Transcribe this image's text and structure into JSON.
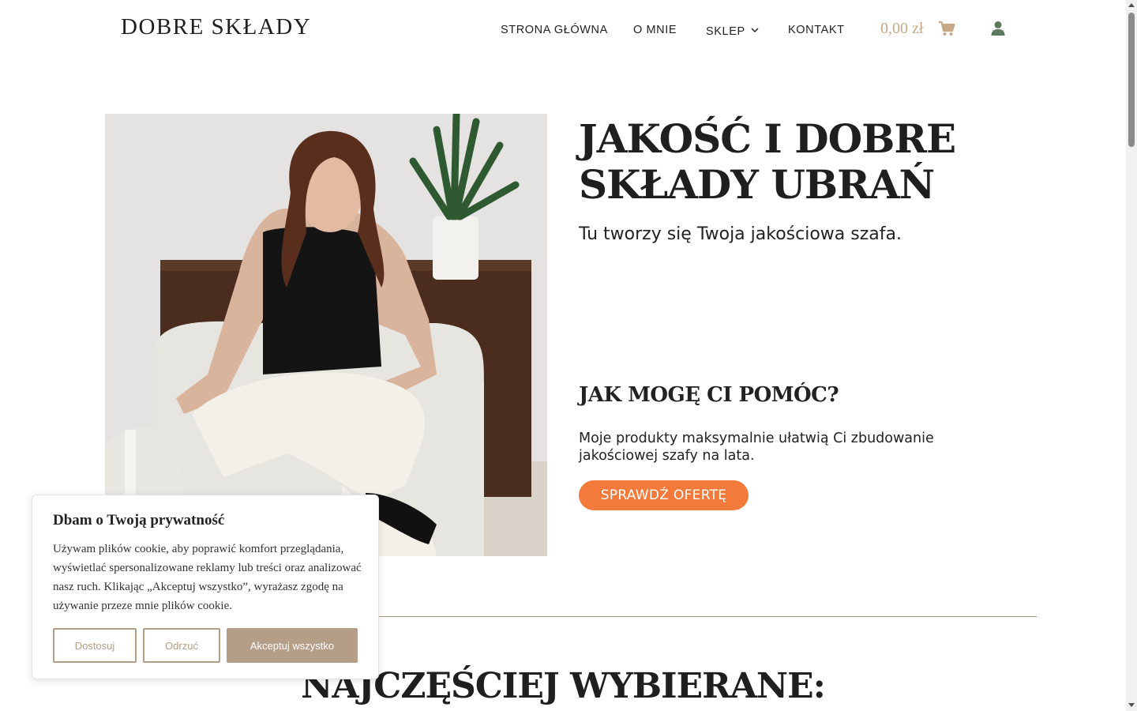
{
  "header": {
    "logo": "DOBRE SKŁADY",
    "nav": {
      "home": "STRONA GŁÓWNA",
      "about": "O MNIE",
      "shop": "SKLEP",
      "contact": "KONTAKT"
    },
    "cart_amount": "0,00 zł"
  },
  "hero": {
    "title": "JAKOŚĆ I DOBRE SKŁADY UBRAŃ",
    "subtitle": "Tu tworzy się Twoja jakościowa szafa.",
    "help_title": "JAK MOGĘ CI POMÓC?",
    "help_text": "Moje produkty maksymalnie ułatwią Ci zbudowanie jakościowej szafy na lata.",
    "cta_label": "SPRAWDŹ OFERTĘ"
  },
  "section": {
    "title": "NAJCZĘŚCIEJ WYBIERANE:"
  },
  "cookie": {
    "title": "Dbam o Twoją prywatność",
    "text": "Używam plików cookie, aby poprawić komfort przeglądania, wyświetlać spersonalizowane reklamy lub treści oraz analizować nasz ruch. Klikając „Akceptuj wszystko”, wyrażasz zgodę na używanie przeze mnie plików cookie.",
    "customize": "Dostosuj",
    "reject": "Odrzuć",
    "accept": "Akceptuj wszystko"
  },
  "icons": {
    "cart": "shopping-cart-icon",
    "user": "user-icon",
    "chevron": "chevron-down-icon"
  },
  "colors": {
    "accent_orange": "#f47a3c",
    "brand_tan": "#b59e88",
    "cart_gold": "#c7a98a",
    "user_green": "#5b7a5e"
  }
}
